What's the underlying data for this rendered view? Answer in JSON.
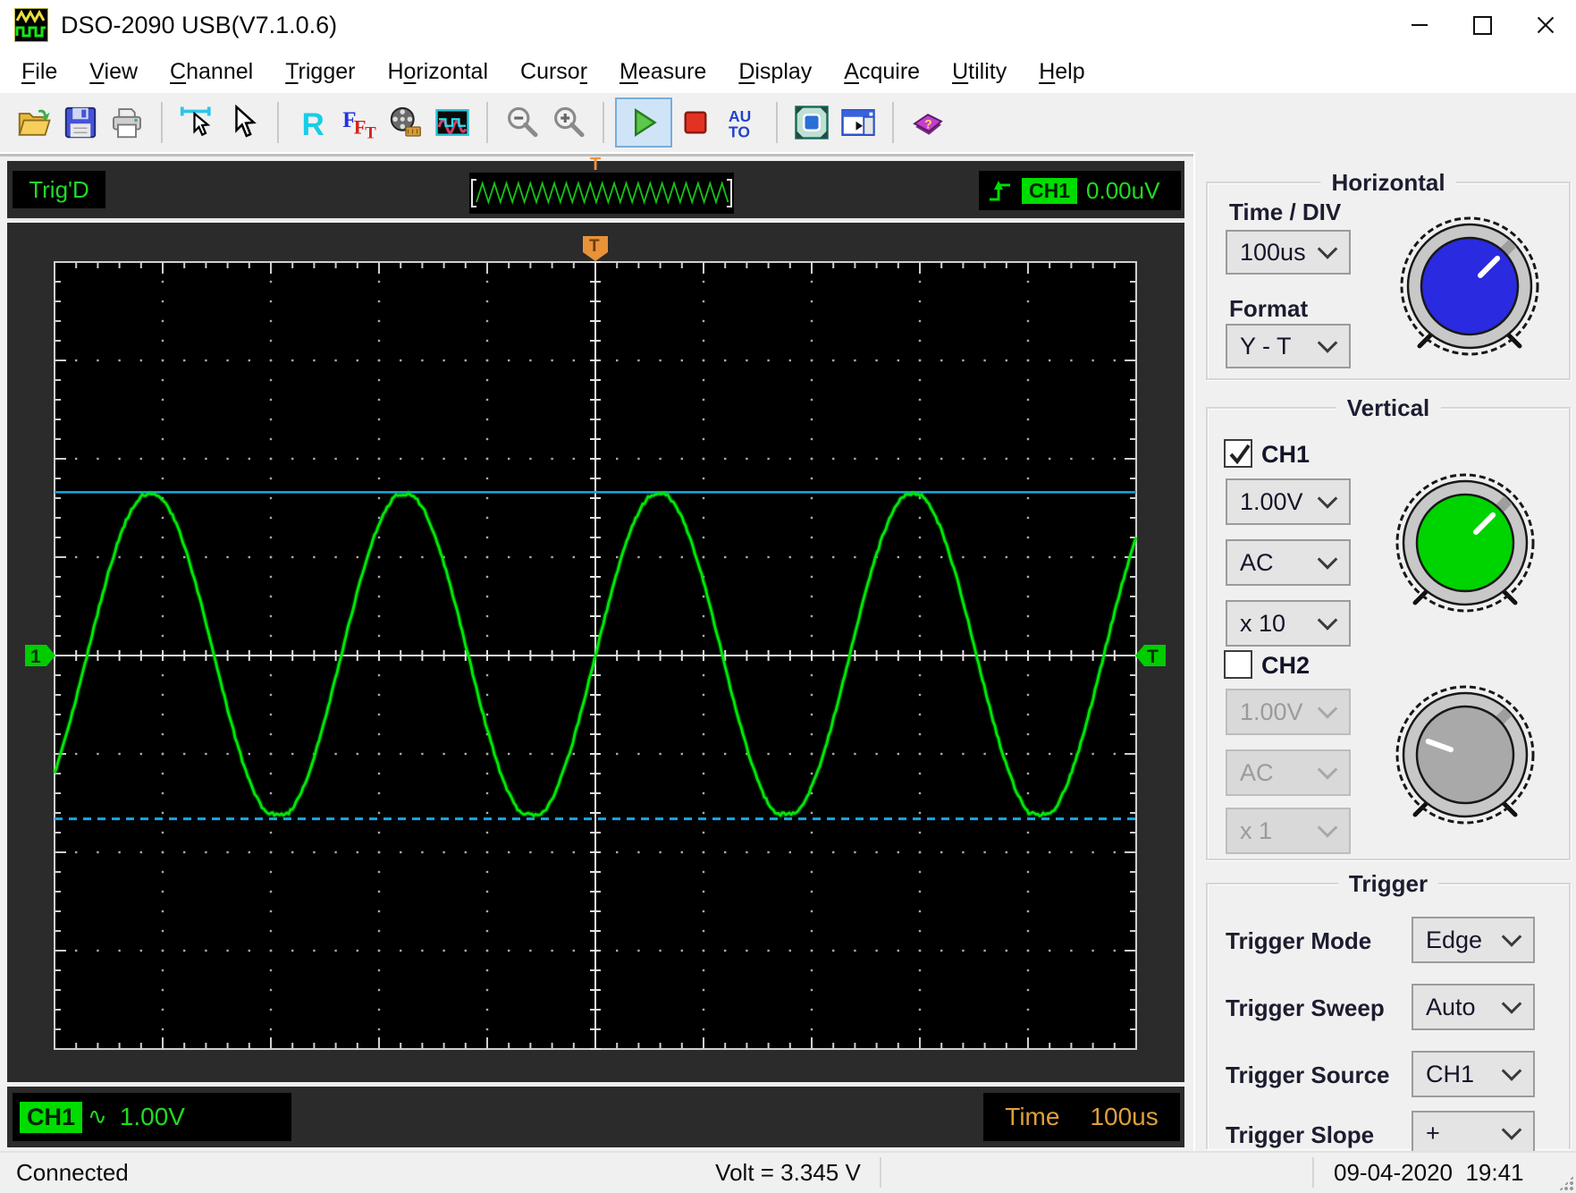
{
  "window": {
    "title": "DSO-2090 USB(V7.1.0.6)"
  },
  "menu": {
    "items": [
      {
        "label": "File",
        "u": 0
      },
      {
        "label": "View",
        "u": 0
      },
      {
        "label": "Channel",
        "u": 0
      },
      {
        "label": "Trigger",
        "u": 0
      },
      {
        "label": "Horizontal",
        "u": 1
      },
      {
        "label": "Cursor",
        "u": 5
      },
      {
        "label": "Measure",
        "u": 0
      },
      {
        "label": "Display",
        "u": 0
      },
      {
        "label": "Acquire",
        "u": 0
      },
      {
        "label": "Utility",
        "u": 0
      },
      {
        "label": "Help",
        "u": 0
      }
    ]
  },
  "toolbar": {
    "buttons": [
      {
        "name": "open-file",
        "icon": "folder"
      },
      {
        "name": "save",
        "icon": "floppy"
      },
      {
        "name": "print",
        "icon": "printer"
      },
      {
        "sep": true
      },
      {
        "name": "cursor-measure",
        "icon": "cursor-measure"
      },
      {
        "name": "pointer",
        "icon": "pointer"
      },
      {
        "sep": true
      },
      {
        "name": "refresh-r",
        "icon": "letter-r",
        "text": "R"
      },
      {
        "name": "fft",
        "icon": "fft",
        "text": "FFT"
      },
      {
        "name": "record-sequence",
        "icon": "film"
      },
      {
        "name": "waveform-window",
        "icon": "waveform"
      },
      {
        "sep": true
      },
      {
        "name": "zoom-out",
        "icon": "zoom-out"
      },
      {
        "name": "zoom-in",
        "icon": "zoom-in"
      },
      {
        "sep": true
      },
      {
        "name": "start-acquisition",
        "icon": "play",
        "active": true
      },
      {
        "name": "stop-acquisition",
        "icon": "stop"
      },
      {
        "name": "auto-set",
        "icon": "auto",
        "text": "AUTO"
      },
      {
        "sep": true
      },
      {
        "name": "full-screen",
        "icon": "screen"
      },
      {
        "name": "panel-layout",
        "icon": "layout"
      },
      {
        "sep": true
      },
      {
        "name": "help-book",
        "icon": "book"
      }
    ]
  },
  "scope": {
    "status": "Trig'D",
    "readout": {
      "channel": "CH1",
      "value": "0.00uV"
    },
    "markers": {
      "left": "1",
      "top": "T",
      "right": "T",
      "preview": "T"
    },
    "channel_label": {
      "name": "CH1",
      "wave": "∿",
      "scale": "1.00V"
    },
    "time_label": {
      "name": "Time",
      "value": "100us"
    },
    "grid": {
      "cols": 10,
      "rows": 8,
      "minor_per_div": 5
    },
    "waveform": {
      "shape": "sine",
      "amplitude_divs": 1.66,
      "period_divs": 2.35,
      "trigger_crossing": "rising at center",
      "vmax_cursor": "solid-cyan",
      "vmin_cursor": "dashed-cyan",
      "volts_per_div": "1.00V",
      "time_per_div": "100us"
    }
  },
  "horizontal_panel": {
    "title": "Horizontal",
    "time_div_label": "Time / DIV",
    "time_div_value": "100us",
    "format_label": "Format",
    "format_value": "Y - T"
  },
  "vertical_panel": {
    "title": "Vertical",
    "ch1": {
      "label": "CH1",
      "checked": true,
      "volts": "1.00V",
      "coupling": "AC",
      "probe": "x 10"
    },
    "ch2": {
      "label": "CH2",
      "checked": false,
      "volts": "1.00V",
      "coupling": "AC",
      "probe": "x 1"
    }
  },
  "trigger_panel": {
    "title": "Trigger",
    "rows": [
      {
        "label": "Trigger Mode",
        "value": "Edge"
      },
      {
        "label": "Trigger Sweep",
        "value": "Auto"
      },
      {
        "label": "Trigger Source",
        "value": "CH1"
      },
      {
        "label": "Trigger Slope",
        "value": "+"
      }
    ]
  },
  "statusbar": {
    "connection": "Connected",
    "measurement": "Volt = 3.345 V",
    "datetime": "09-04-2020  19:41"
  },
  "colors": {
    "trace": "#00e408",
    "cursor_cyan": "#1aa7e1",
    "marker_orange": "#e8923a",
    "marker_green": "#00cc00",
    "badge_green": "#00dc00",
    "time_orange": "#df9f3a",
    "knob_blue": "#2a2ae0",
    "knob_green": "#00d400",
    "knob_gray": "#a9a9a9"
  }
}
